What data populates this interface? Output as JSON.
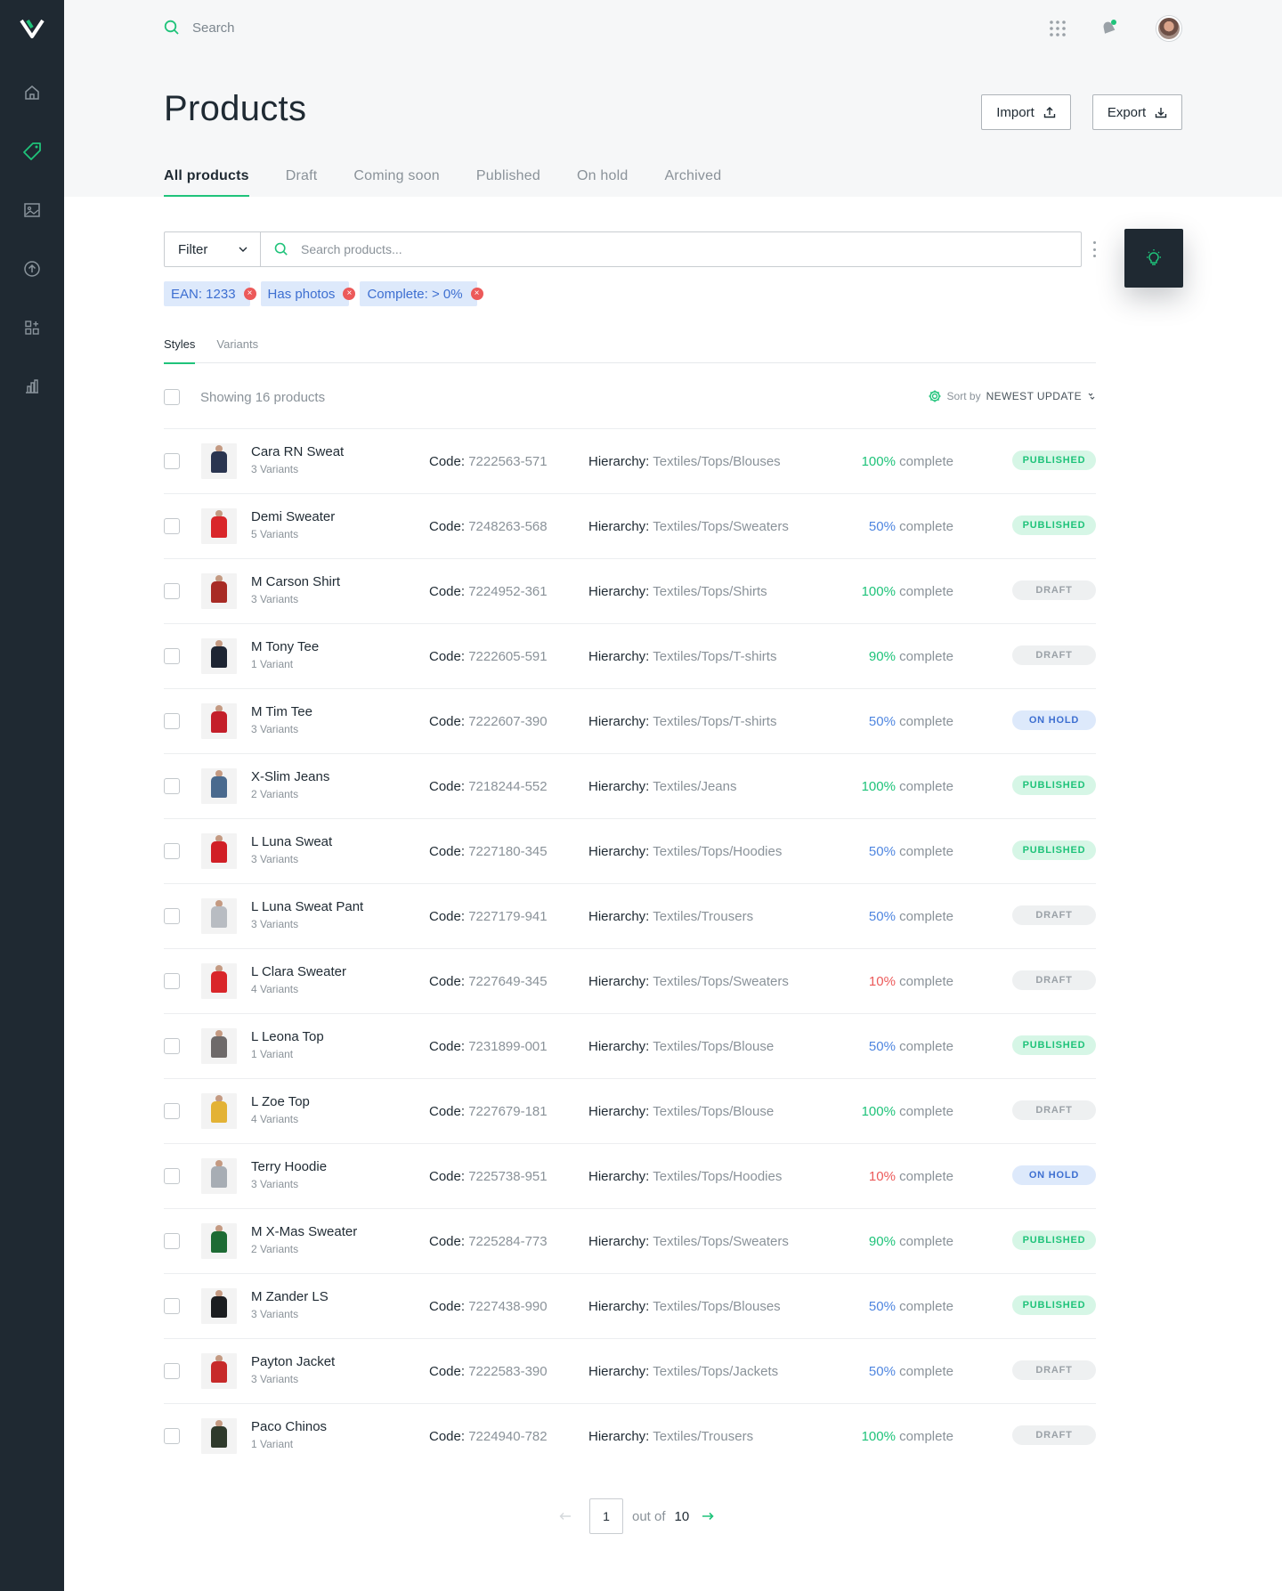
{
  "nav": {
    "items": [
      {
        "name": "home-icon"
      },
      {
        "name": "tag-icon",
        "active": true
      },
      {
        "name": "image-icon"
      },
      {
        "name": "upload-icon"
      },
      {
        "name": "widgets-icon"
      },
      {
        "name": "chart-icon"
      }
    ]
  },
  "header": {
    "search_placeholder": "Search"
  },
  "page": {
    "title": "Products",
    "import_label": "Import",
    "export_label": "Export"
  },
  "tabs": [
    "All products",
    "Draft",
    "Coming soon",
    "Published",
    "On hold",
    "Archived"
  ],
  "filter": {
    "label": "Filter",
    "search_placeholder": "Search products..."
  },
  "chips": [
    "EAN: 1233",
    "Has photos",
    "Complete: > 0%"
  ],
  "subtabs": [
    "Styles",
    "Variants"
  ],
  "list": {
    "showing": "Showing 16 products",
    "sort_prefix": "Sort by",
    "sort_value": "NEWEST UPDATE"
  },
  "labels": {
    "code": "Code:",
    "hierarchy": "Hierarchy:",
    "complete": "complete"
  },
  "colors": {
    "accent": "#1fc37a",
    "pct_high": "#1fc37a",
    "pct_mid": "#4f86e0",
    "pct_low": "#ec5a5a",
    "published_bg": "#d6f6e6",
    "published_fg": "#1fc37a",
    "draft_bg": "#eef0f1",
    "draft_fg": "#9aa1a7",
    "onhold_bg": "#dde9fb",
    "onhold_fg": "#3d6fd1"
  },
  "products": [
    {
      "name": "Cara RN Sweat",
      "variants": "3 Variants",
      "code": "7222563-571",
      "hierarchy": "Textiles/Tops/Blouses",
      "pct": "100%",
      "status": "PUBLISHED",
      "thumb": "#2a3550"
    },
    {
      "name": "Demi Sweater",
      "variants": "5 Variants",
      "code": "7248263-568",
      "hierarchy": "Textiles/Tops/Sweaters",
      "pct": "50%",
      "status": "PUBLISHED",
      "thumb": "#d9262a"
    },
    {
      "name": "M Carson Shirt",
      "variants": "3 Variants",
      "code": "7224952-361",
      "hierarchy": "Textiles/Tops/Shirts",
      "pct": "100%",
      "status": "DRAFT",
      "thumb": "#a82b25"
    },
    {
      "name": "M Tony Tee",
      "variants": "1 Variant",
      "code": "7222605-591",
      "hierarchy": "Textiles/Tops/T-shirts",
      "pct": "90%",
      "status": "DRAFT",
      "thumb": "#1e2533"
    },
    {
      "name": "M Tim Tee",
      "variants": "3 Variants",
      "code": "7222607-390",
      "hierarchy": "Textiles/Tops/T-shirts",
      "pct": "50%",
      "status": "ON HOLD",
      "thumb": "#c41f2a"
    },
    {
      "name": "X-Slim Jeans",
      "variants": "2 Variants",
      "code": "7218244-552",
      "hierarchy": "Textiles/Jeans",
      "pct": "100%",
      "status": "PUBLISHED",
      "thumb": "#4a6a8e"
    },
    {
      "name": "L Luna Sweat",
      "variants": "3 Variants",
      "code": "7227180-345",
      "hierarchy": "Textiles/Tops/Hoodies",
      "pct": "50%",
      "status": "PUBLISHED",
      "thumb": "#d11f26"
    },
    {
      "name": "L Luna Sweat Pant",
      "variants": "3 Variants",
      "code": "7227179-941",
      "hierarchy": "Textiles/Trousers",
      "pct": "50%",
      "status": "DRAFT",
      "thumb": "#b8bcc2"
    },
    {
      "name": "L Clara Sweater",
      "variants": "4 Variants",
      "code": "7227649-345",
      "hierarchy": "Textiles/Tops/Sweaters",
      "pct": "10%",
      "status": "DRAFT",
      "thumb": "#d9262a"
    },
    {
      "name": "L Leona Top",
      "variants": "1 Variant",
      "code": "7231899-001",
      "hierarchy": "Textiles/Tops/Blouse",
      "pct": "50%",
      "status": "PUBLISHED",
      "thumb": "#6e6a6a"
    },
    {
      "name": "L Zoe Top",
      "variants": "4 Variants",
      "code": "7227679-181",
      "hierarchy": "Textiles/Tops/Blouse",
      "pct": "100%",
      "status": "DRAFT",
      "thumb": "#e3b235"
    },
    {
      "name": "Terry Hoodie",
      "variants": "3 Variants",
      "code": "7225738-951",
      "hierarchy": "Textiles/Tops/Hoodies",
      "pct": "10%",
      "status": "ON HOLD",
      "thumb": "#a7adb4"
    },
    {
      "name": "M X-Mas Sweater",
      "variants": "2 Variants",
      "code": "7225284-773",
      "hierarchy": "Textiles/Tops/Sweaters",
      "pct": "90%",
      "status": "PUBLISHED",
      "thumb": "#1d6b34"
    },
    {
      "name": "M Zander LS",
      "variants": "3 Variants",
      "code": "7227438-990",
      "hierarchy": "Textiles/Tops/Blouses",
      "pct": "50%",
      "status": "PUBLISHED",
      "thumb": "#1b1d20"
    },
    {
      "name": "Payton Jacket",
      "variants": "3 Variants",
      "code": "7222583-390",
      "hierarchy": "Textiles/Tops/Jackets",
      "pct": "50%",
      "status": "DRAFT",
      "thumb": "#c72a2a"
    },
    {
      "name": "Paco Chinos",
      "variants": "1 Variant",
      "code": "7224940-782",
      "hierarchy": "Textiles/Trousers",
      "pct": "100%",
      "status": "DRAFT",
      "thumb": "#2f3a2c"
    }
  ],
  "pagination": {
    "current": "1",
    "out_of": "out of",
    "total": "10"
  }
}
